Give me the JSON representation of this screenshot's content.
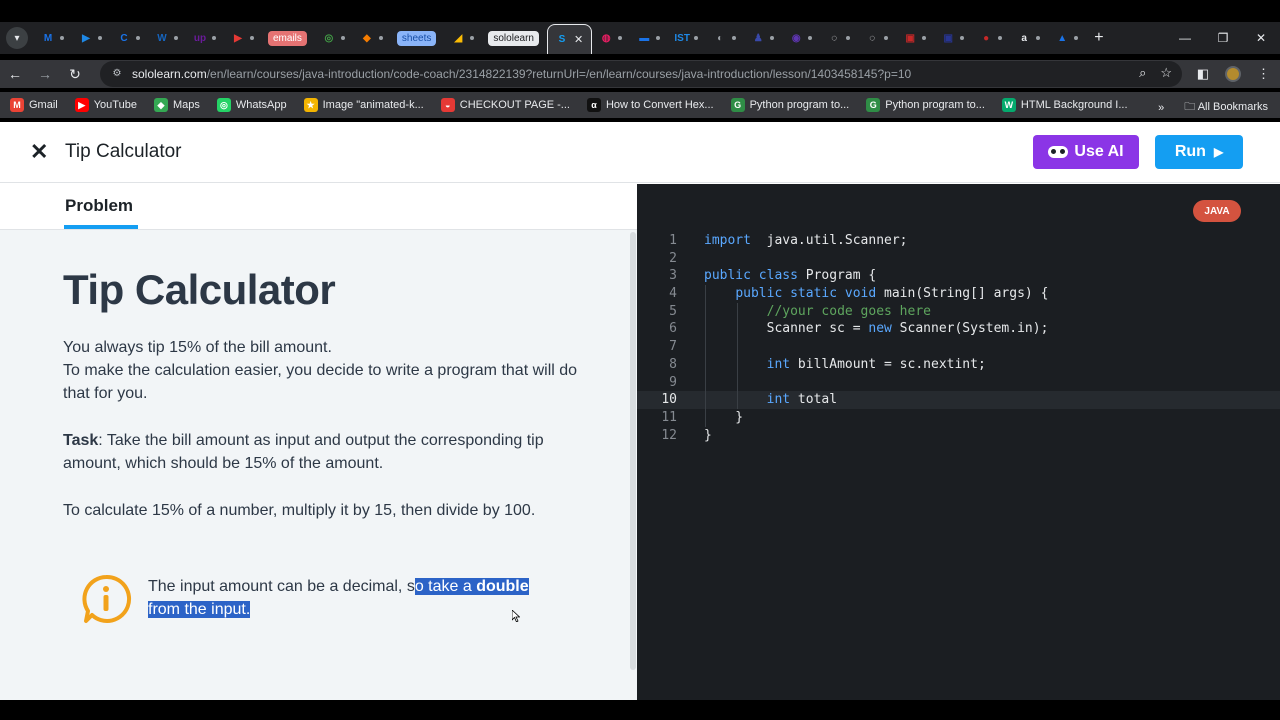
{
  "browser": {
    "tabs": [
      {
        "name": "tab-search",
        "label": ""
      },
      {
        "fav": "M",
        "color": "#1a73e8"
      },
      {
        "fav": "▶",
        "color": "#1e88e5"
      },
      {
        "fav": "C",
        "color": "#1a73e8"
      },
      {
        "fav": "W",
        "color": "#1565c0"
      },
      {
        "fav": "up",
        "color": "#6a1b9a"
      },
      {
        "fav": "▶",
        "color": "#e53935"
      },
      {
        "pill": "emails",
        "color": "#e57373"
      },
      {
        "fav": "◎",
        "color": "#43a047"
      },
      {
        "fav": "◆",
        "color": "#f57c00"
      },
      {
        "pill": "sheets",
        "color": "#8ab4f8"
      },
      {
        "fav": "◢",
        "color": "#fbbc04"
      },
      {
        "pill": "sololearn",
        "color": "#e8eaed"
      },
      {
        "active": true,
        "fav": "S",
        "color": "#149ef2"
      },
      {
        "fav": "◍",
        "color": "#e91e63"
      },
      {
        "fav": "▬",
        "color": "#1a73e8"
      },
      {
        "fav": "IST",
        "color": "#1e88e5"
      },
      {
        "fav": "◐",
        "color": "#9aa0a6"
      },
      {
        "fav": "♟",
        "color": "#3949ab"
      },
      {
        "fav": "◉",
        "color": "#5e35b1"
      },
      {
        "fav": "◌",
        "color": "#e8eaed"
      },
      {
        "fav": "◌",
        "color": "#e8eaed"
      },
      {
        "fav": "▣",
        "color": "#c62828"
      },
      {
        "fav": "▣",
        "color": "#283593"
      },
      {
        "fav": "●",
        "color": "#c62828"
      },
      {
        "fav": "a",
        "color": "#e8eaed"
      },
      {
        "fav": "▲",
        "color": "#1a73e8"
      }
    ],
    "new_tab": "+",
    "url_host": "sololearn.com",
    "url_path": "/en/learn/courses/java-introduction/code-coach/2314822139?returnUrl=/en/learn/courses/java-introduction/lesson/1403458145?p=10",
    "bookmarks": [
      {
        "label": "Gmail",
        "icon": "gmail-icon",
        "color": "#ea4335",
        "glyph": "M"
      },
      {
        "label": "YouTube",
        "icon": "youtube-icon",
        "color": "#ff0000",
        "glyph": "▶"
      },
      {
        "label": "Maps",
        "icon": "maps-icon",
        "color": "#34a853",
        "glyph": "◆"
      },
      {
        "label": "WhatsApp",
        "icon": "whatsapp-icon",
        "color": "#25d366",
        "glyph": "◎"
      },
      {
        "label": "Image \"animated-k...",
        "icon": "star-icon",
        "color": "#f4b400",
        "glyph": "★"
      },
      {
        "label": "CHECKOUT PAGE -...",
        "icon": "lips-icon",
        "color": "#e53935",
        "glyph": "◒"
      },
      {
        "label": "How to Convert Hex...",
        "icon": "alpha-icon",
        "color": "#111111",
        "glyph": "α"
      },
      {
        "label": "Python program to...",
        "icon": "gfg-icon",
        "color": "#2f8d46",
        "glyph": "G"
      },
      {
        "label": "Python program to...",
        "icon": "gfg-icon",
        "color": "#2f8d46",
        "glyph": "G"
      },
      {
        "label": "HTML Background I...",
        "icon": "w3-icon",
        "color": "#04aa6d",
        "glyph": "W"
      }
    ],
    "all_bookmarks": "All Bookmarks"
  },
  "header": {
    "title": "Tip Calculator",
    "use_ai": "Use AI",
    "run": "Run"
  },
  "lesson": {
    "tab": "Problem",
    "heading": "Tip Calculator",
    "p1": "You always tip 15% of the bill amount.\nTo make the calculation easier, you decide to write a program that will do that for you.",
    "task_label": "Task",
    "task_text": ": Take the bill amount as input and output the corresponding tip amount, which should be 15% of the amount.",
    "p3": "To calculate 15% of a number, multiply it by 15, then divide by 100.",
    "info_a": "The input amount can be a decimal, s",
    "info_b": "o take a ",
    "info_bold": "double",
    "info_c": "from the input."
  },
  "editor": {
    "language": "JAVA",
    "current_line": 10,
    "lines": [
      {
        "n": "1",
        "tokens": [
          [
            "kw",
            "import"
          ],
          [
            "",
            "  java.util.Scanner;"
          ]
        ],
        "indent": 0
      },
      {
        "n": "2",
        "tokens": [],
        "indent": 0
      },
      {
        "n": "3",
        "tokens": [
          [
            "kw",
            "public class"
          ],
          [
            "",
            " Program {"
          ]
        ],
        "indent": 0
      },
      {
        "n": "4",
        "tokens": [
          [
            "",
            "    "
          ],
          [
            "kw",
            "public static void"
          ],
          [
            "",
            " main(String[] args) {"
          ]
        ],
        "indent": 1
      },
      {
        "n": "5",
        "tokens": [
          [
            "",
            "        "
          ],
          [
            "cm",
            "//your code goes here"
          ]
        ],
        "indent": 2
      },
      {
        "n": "6",
        "tokens": [
          [
            "",
            "        Scanner sc = "
          ],
          [
            "kw",
            "new"
          ],
          [
            "",
            " Scanner(System.in);"
          ]
        ],
        "indent": 2
      },
      {
        "n": "7",
        "tokens": [],
        "indent": 2
      },
      {
        "n": "8",
        "tokens": [
          [
            "",
            "        "
          ],
          [
            "kw",
            "int"
          ],
          [
            "",
            " billAmount = sc.nextint;"
          ]
        ],
        "indent": 2
      },
      {
        "n": "9",
        "tokens": [],
        "indent": 2
      },
      {
        "n": "10",
        "tokens": [
          [
            "",
            "        "
          ],
          [
            "kw",
            "int"
          ],
          [
            "",
            " total"
          ]
        ],
        "indent": 2
      },
      {
        "n": "11",
        "tokens": [
          [
            "",
            "    }"
          ]
        ],
        "indent": 1
      },
      {
        "n": "12",
        "tokens": [
          [
            "",
            "}"
          ]
        ],
        "indent": 0
      }
    ]
  }
}
